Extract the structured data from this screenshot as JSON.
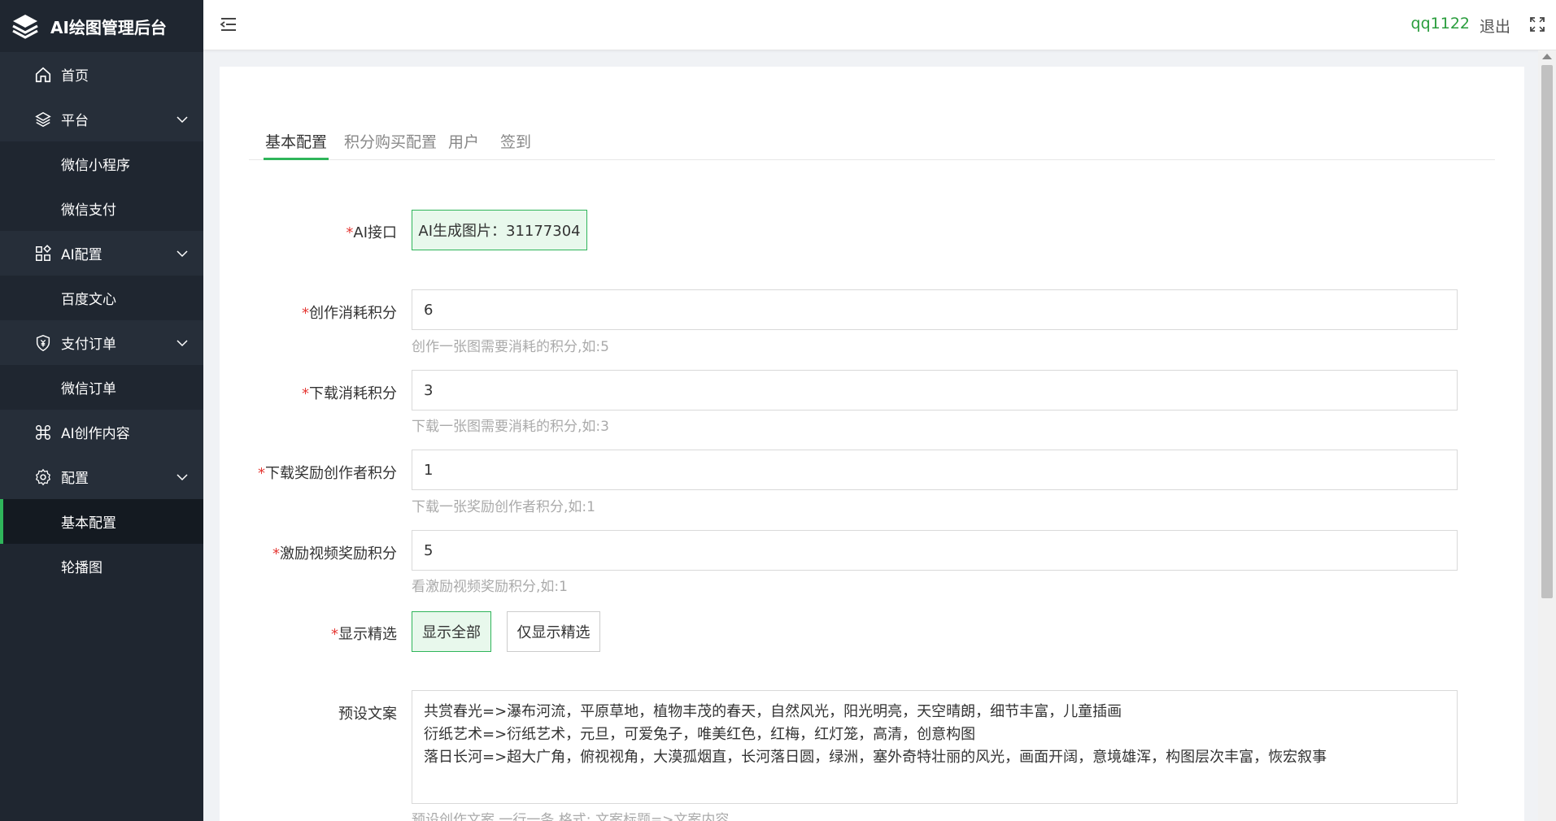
{
  "app": {
    "title": "AI绘图管理后台"
  },
  "sidebar": {
    "items": [
      {
        "label": "首页"
      },
      {
        "label": "平台"
      },
      {
        "label": "微信小程序"
      },
      {
        "label": "微信支付"
      },
      {
        "label": "AI配置"
      },
      {
        "label": "百度文心"
      },
      {
        "label": "支付订单"
      },
      {
        "label": "微信订单"
      },
      {
        "label": "AI创作内容"
      },
      {
        "label": "配置"
      },
      {
        "label": "基本配置"
      },
      {
        "label": "轮播图"
      }
    ]
  },
  "header": {
    "user": "qq1122",
    "logout": "退出"
  },
  "tabs": [
    {
      "label": "基本配置"
    },
    {
      "label": "积分购买配置"
    },
    {
      "label": "用户"
    },
    {
      "label": "签到"
    }
  ],
  "form": {
    "ai_api": {
      "label": "AI接口",
      "value": "AI生成图片：31177304"
    },
    "create_cost": {
      "label": "创作消耗积分",
      "value": "6",
      "hint": "创作一张图需要消耗的积分,如:5"
    },
    "download_cost": {
      "label": "下载消耗积分",
      "value": "3",
      "hint": "下载一张图需要消耗的积分,如:3"
    },
    "download_reward": {
      "label": "下载奖励创作者积分",
      "value": "1",
      "hint": "下载一张奖励创作者积分,如:1"
    },
    "video_reward": {
      "label": "激励视频奖励积分",
      "value": "5",
      "hint": "看激励视频奖励积分,如:1"
    },
    "display": {
      "label": "显示精选",
      "option_all": "显示全部",
      "option_featured": "仅显示精选"
    },
    "preset": {
      "label": "预设文案",
      "lines": [
        "共赏春光=>瀑布河流，平原草地，植物丰茂的春天，自然风光，阳光明亮，天空晴朗，细节丰富，儿童插画",
        "衍纸艺术=>衍纸艺术，元旦，可爱兔子，唯美红色，红梅，红灯笼，高清，创意构图",
        "落日长河=>超大广角，俯视视角，大漠孤烟直，长河落日圆，绿洲，塞外奇特壮丽的风光，画面开阔，意境雄浑，构图层次丰富，恢宏叙事"
      ],
      "hint": "预设创作文案,一行一条,格式: 文案标题=>文案内容"
    }
  }
}
